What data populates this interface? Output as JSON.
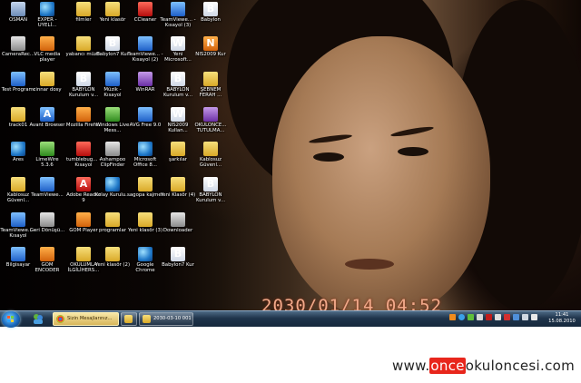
{
  "desktop": {
    "timestamp": "2030/01/14  04:52",
    "icons": [
      {
        "label": "OSMAN",
        "icon": "user-folder-icon"
      },
      {
        "label": "CameraRec...",
        "icon": "camera-icon"
      },
      {
        "label": "Test Programı",
        "icon": "program-icon"
      },
      {
        "label": "track01",
        "icon": "folder-icon"
      },
      {
        "label": "Ares",
        "icon": "ares-icon"
      },
      {
        "label": "Kablosuz Güvenl...",
        "icon": "folder-icon"
      },
      {
        "label": "TeamViewe... - Kısayol",
        "icon": "teamviewer-icon"
      },
      {
        "label": "Bilgisayar",
        "icon": "computer-icon"
      },
      {
        "label": "EXPER - UYELİ...",
        "icon": "globe-icon"
      },
      {
        "label": "VLC media player",
        "icon": "vlc-icon"
      },
      {
        "label": "cinnar dosy",
        "icon": "folder-icon"
      },
      {
        "label": "Avant Browser",
        "icon": "avant-icon"
      },
      {
        "label": "LimeWire 5.3.6",
        "icon": "limewire-icon"
      },
      {
        "label": "TeamViewe...",
        "icon": "teamviewer-icon"
      },
      {
        "label": "Geri Dönüşü...",
        "icon": "recycle-bin-icon"
      },
      {
        "label": "GOM ENCODER",
        "icon": "gom-icon"
      },
      {
        "label": "filmler",
        "icon": "folder-icon"
      },
      {
        "label": "yabancı müzik",
        "icon": "folder-icon"
      },
      {
        "label": "BABYLON Kurulum v...",
        "icon": "babylon-icon"
      },
      {
        "label": "Mozilla Firefox",
        "icon": "firefox-icon"
      },
      {
        "label": "tumblebug... - Kısayol",
        "icon": "game-icon"
      },
      {
        "label": "Adobe Reader 9",
        "icon": "adobe-reader-icon"
      },
      {
        "label": "GOM Player",
        "icon": "gom-icon"
      },
      {
        "label": "OKULUMLA İLGİLİHERS...",
        "icon": "folder-icon"
      },
      {
        "label": "Yeni klasör",
        "icon": "folder-icon"
      },
      {
        "label": "Babylon7 Kur",
        "icon": "babylon-icon"
      },
      {
        "label": "Müzik - Kısayol",
        "icon": "music-icon"
      },
      {
        "label": "Windows Live Mess...",
        "icon": "messenger-icon"
      },
      {
        "label": "Ashampoo ClipFinder",
        "icon": "ashampoo-icon"
      },
      {
        "label": "Kolay Kurulu...",
        "icon": "installer-icon"
      },
      {
        "label": "programlar",
        "icon": "folder-icon"
      },
      {
        "label": "Yeni klasör (2)",
        "icon": "folder-icon"
      },
      {
        "label": "CCleaner",
        "icon": "ccleaner-icon"
      },
      {
        "label": "TeamViewe... - Kısayol (2)",
        "icon": "teamviewer-icon"
      },
      {
        "label": "WinRAR",
        "icon": "winrar-icon"
      },
      {
        "label": "AVG Free 9.0",
        "icon": "avg-icon"
      },
      {
        "label": "Microsoft Office 8...",
        "icon": "office-icon"
      },
      {
        "label": "sagopa kajmer",
        "icon": "folder-icon"
      },
      {
        "label": "Yeni klasör (3)",
        "icon": "folder-icon"
      },
      {
        "label": "Google Chrome",
        "icon": "chrome-icon"
      },
      {
        "label": "TeamViewe... - Kısayol (3)",
        "icon": "teamviewer-icon"
      },
      {
        "label": "Yeni Microsoft...",
        "icon": "document-icon"
      },
      {
        "label": "BABYLON Kurulum v...",
        "icon": "babylon-icon"
      },
      {
        "label": "NIS2009 Kullan...",
        "icon": "document-icon"
      },
      {
        "label": "şarkılar",
        "icon": "folder-icon"
      },
      {
        "label": "Yeni Klasör (4)",
        "icon": "folder-icon"
      },
      {
        "label": "Downloader",
        "icon": "downloader-icon"
      },
      {
        "label": "Babylon7 Kur",
        "icon": "babylon-icon"
      },
      {
        "label": "Babylon",
        "icon": "babylon-icon"
      },
      {
        "label": "NIS2009 Kur",
        "icon": "nis-icon"
      },
      {
        "label": "ŞEBNEM FERAH ...",
        "icon": "folder-icon"
      },
      {
        "label": "OKULONCE... TUTULMA...",
        "icon": "winrar-icon"
      },
      {
        "label": "Kablosuz Güvenl...",
        "icon": "folder-icon"
      },
      {
        "label": "BABYLON Kurulum v...",
        "icon": "babylon-icon"
      }
    ]
  },
  "taskbar": {
    "tasks": [
      {
        "label": "Sizin Mesajlarınız...",
        "icon": "chrome-icon",
        "active": true
      },
      {
        "label": "",
        "icon": "folder-icon",
        "active": false
      },
      {
        "label": "2030-03-10 001",
        "icon": "folder-icon",
        "active": false
      }
    ],
    "clock_time": "11:41",
    "clock_date": "15.08.2010"
  },
  "watermark": {
    "prefix": "www.",
    "highlight": "once",
    "rest": "okuloncesi.com"
  }
}
